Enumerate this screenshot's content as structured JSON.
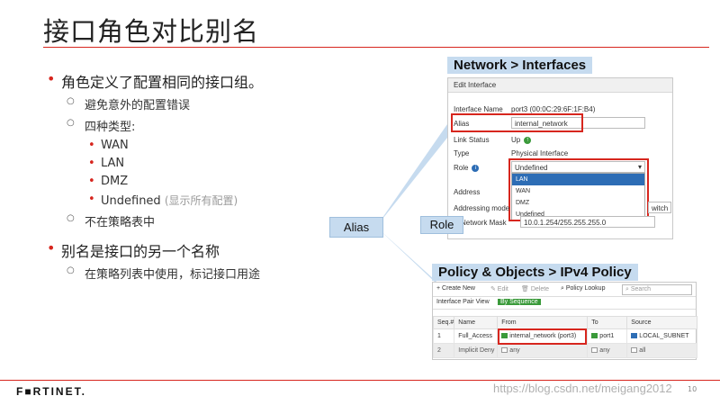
{
  "slide": {
    "title": "接口角色对比别名",
    "bullets": {
      "b1": "角色定义了配置相同的接口组。",
      "b1_sub1": "避免意外的配置错误",
      "b1_sub2": "四种类型:",
      "types": [
        "WAN",
        "LAN",
        "DMZ",
        "Undefined"
      ],
      "undefined_note": "(显示所有配置)",
      "b1_sub3": "不在策略表中",
      "b2": "别名是接口的另一个名称",
      "b2_sub1": "在策略列表中使用，标记接口用途"
    }
  },
  "network_section": {
    "label": "Network > Interfaces",
    "panel_title": "Edit Interface",
    "interface_name_label": "Interface Name",
    "interface_name_value": "port3 (00:0C:29:6F:1F:B4)",
    "alias_label": "Alias",
    "alias_value": "internal_network",
    "link_status_label": "Link Status",
    "link_status_value": "Up",
    "type_label": "Type",
    "type_value": "Physical Interface",
    "role_label": "Role",
    "role_value": "Undefined",
    "role_options": [
      "LAN",
      "WAN",
      "DMZ",
      "Undefined"
    ],
    "address_label": "Address",
    "addressing_mode_label": "Addressing mode",
    "switch_label": "witch",
    "netmask_label": "Network Mask",
    "netmask_value": "10.0.1.254/255.255.255.0"
  },
  "policy_section": {
    "label": "Policy & Objects > IPv4 Policy",
    "toolbar": {
      "create_new": "+ Create New",
      "edit": "✎ Edit",
      "delete": "🗑 Delete",
      "lookup": "Policy Lookup",
      "search_placeholder": "Search"
    },
    "views": {
      "pair_view": "Interface Pair View",
      "by_sequence": "By Sequence"
    },
    "columns": [
      "Seq.#",
      "Name",
      "From",
      "To",
      "Source"
    ],
    "rows": [
      {
        "seq": "1",
        "name": "Full_Access",
        "from": "internal_network (port3)",
        "to": "port1",
        "source": "LOCAL_SUBNET"
      },
      {
        "seq": "2",
        "name": "Implicit Deny",
        "from": "any",
        "to": "any",
        "source": "all"
      }
    ]
  },
  "callouts": {
    "alias": "Alias",
    "role": "Role"
  },
  "footer": {
    "logo": "F■RTINET.",
    "watermark": "https://blog.csdn.net/meigang2012",
    "page_number": "10"
  },
  "colors": {
    "accent_red": "#d7261e",
    "callout_blue": "#c6dbef",
    "active_green": "#3a9a3a"
  }
}
